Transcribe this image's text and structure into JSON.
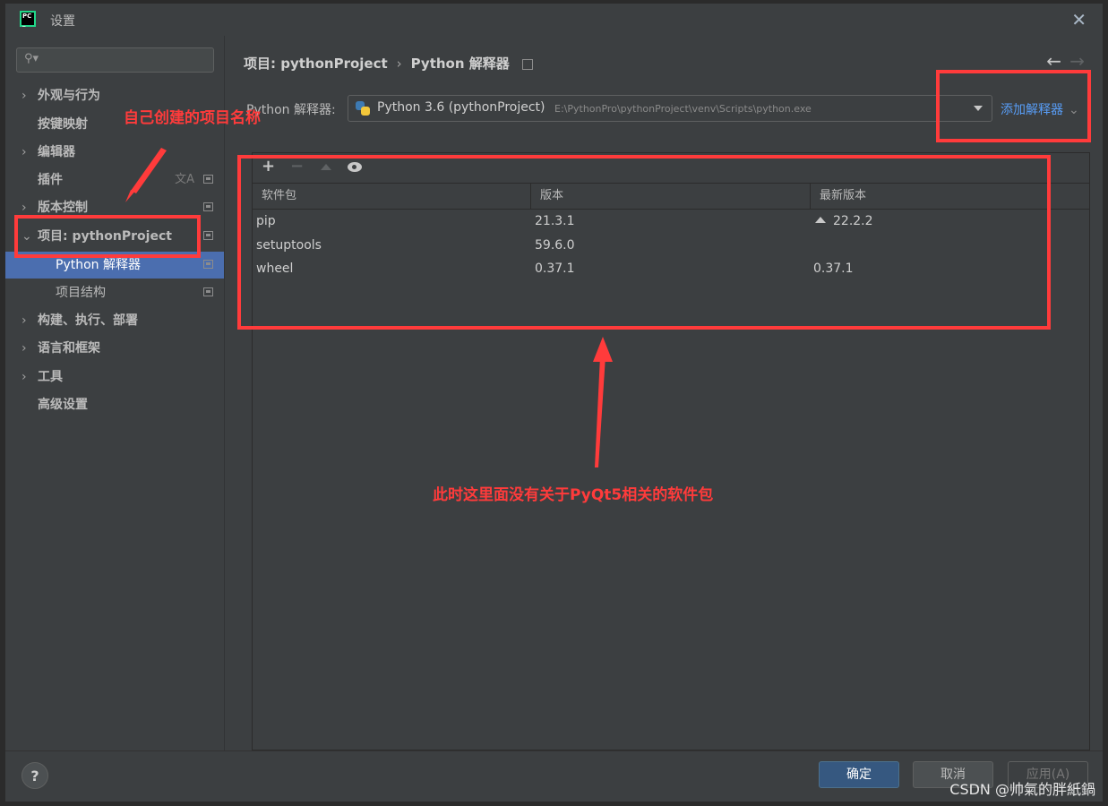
{
  "window": {
    "title": "设置",
    "app_icon": "pycharm-logo-icon",
    "close": "✕"
  },
  "sidebar": {
    "search": {
      "placeholder": "",
      "icon": "search-icon"
    },
    "items": [
      {
        "label": "外观与行为",
        "expandable": true
      },
      {
        "label": "按键映射",
        "expandable": false
      },
      {
        "label": "编辑器",
        "expandable": true
      },
      {
        "label": "插件",
        "expandable": false
      },
      {
        "label": "版本控制",
        "expandable": true
      },
      {
        "label": "项目: pythonProject",
        "expandable": true,
        "expanded": true
      },
      {
        "label": "Python 解释器",
        "sub": true,
        "selected": true
      },
      {
        "label": "项目结构",
        "sub": true
      },
      {
        "label": "构建、执行、部署",
        "expandable": true
      },
      {
        "label": "语言和框架",
        "expandable": true
      },
      {
        "label": "工具",
        "expandable": true
      },
      {
        "label": "高级设置",
        "expandable": false
      }
    ],
    "help": "?"
  },
  "breadcrumb": {
    "project": "项目: pythonProject",
    "separator": "›",
    "page": "Python 解释器"
  },
  "interpreter": {
    "label": "Python 解释器:",
    "name": "Python 3.6 (pythonProject)",
    "path": "E:\\PythonPro\\pythonProject\\venv\\Scripts\\python.exe",
    "add_label": "添加解释器"
  },
  "packages": {
    "toolbar": {
      "add": "+",
      "remove": "−"
    },
    "columns": [
      "软件包",
      "版本",
      "最新版本"
    ],
    "rows": [
      {
        "name": "pip",
        "version": "21.3.1",
        "latest": "22.2.2",
        "upgrade": true
      },
      {
        "name": "setuptools",
        "version": "59.6.0",
        "latest": "",
        "upgrade": false
      },
      {
        "name": "wheel",
        "version": "0.37.1",
        "latest": "0.37.1",
        "upgrade": false
      }
    ]
  },
  "footer": {
    "ok": "确定",
    "cancel": "取消",
    "apply": "应用(A)"
  },
  "annotations": {
    "project_name_note": "自己创建的项目名称",
    "packages_note": "此时这里面没有关于PyQt5相关的软件包",
    "watermark": "CSDN @帅氣的胖紙鍋"
  },
  "colors": {
    "selection": "#4b6eaf",
    "link": "#589df6",
    "annotation": "#ff3b3b",
    "ok_button": "#365880"
  }
}
